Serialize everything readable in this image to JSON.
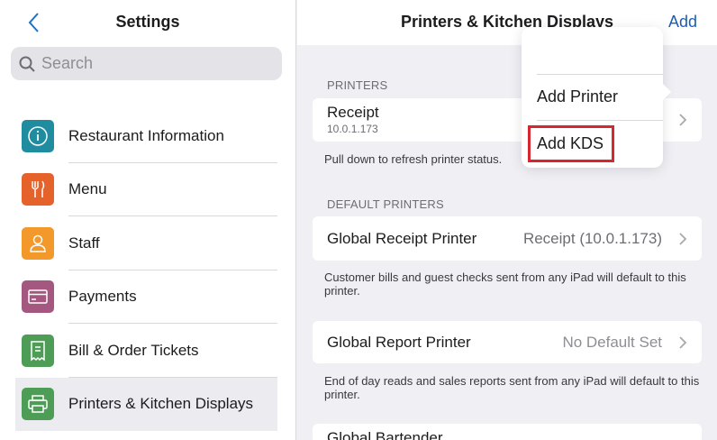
{
  "sidebar": {
    "title": "Settings",
    "search_placeholder": "Search",
    "items": [
      {
        "label": "Restaurant Information",
        "color": "#1f8ca0",
        "icon": "info-icon"
      },
      {
        "label": "Menu",
        "color": "#e5622b",
        "icon": "fork-knife-icon"
      },
      {
        "label": "Staff",
        "color": "#f3982b",
        "icon": "person-icon"
      },
      {
        "label": "Payments",
        "color": "#a4577f",
        "icon": "credit-card-icon"
      },
      {
        "label": "Bill & Order Tickets",
        "color": "#4e9d56",
        "icon": "receipt-icon"
      },
      {
        "label": "Printers & Kitchen Displays",
        "color": "#4e9d56",
        "icon": "printer-icon"
      }
    ]
  },
  "main": {
    "title": "Printers & Kitchen Displays",
    "add_label": "Add",
    "printers_header": "PRINTERS",
    "receipt": {
      "name": "Receipt",
      "ip": "10.0.1.173"
    },
    "refresh_note": "Pull down to refresh printer status.",
    "default_header": "DEFAULT PRINTERS",
    "global_receipt": {
      "name": "Global Receipt Printer",
      "value": "Receipt (10.0.1.173)"
    },
    "global_receipt_note": "Customer bills and guest checks sent from any iPad will default to this printer.",
    "global_report": {
      "name": "Global Report Printer",
      "value": "No Default Set"
    },
    "global_report_note": "End of day reads and sales reports sent from any iPad will default to this printer.",
    "global_bartender": {
      "name": "Global Bartender"
    }
  },
  "popover": {
    "items": [
      "Add Printer",
      "Add KDS"
    ]
  },
  "colors": {
    "accent": "#1a5fb4",
    "highlight": "#d8262f"
  }
}
